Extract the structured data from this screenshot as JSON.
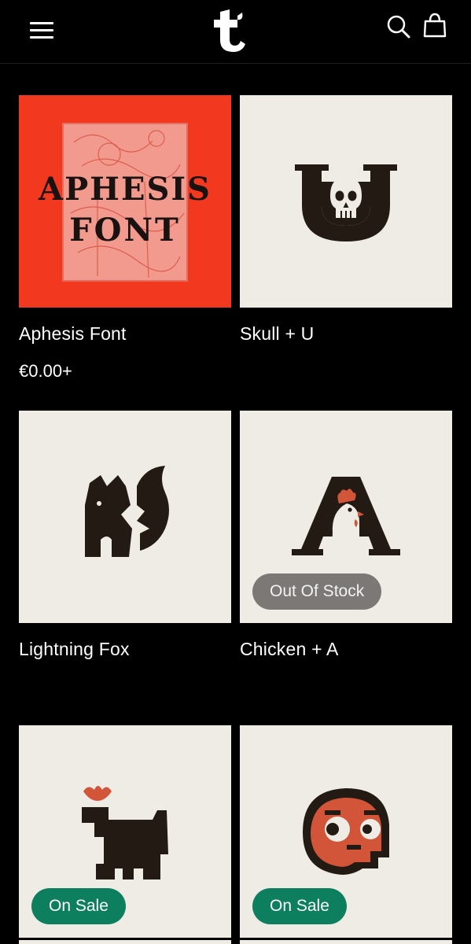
{
  "header": {
    "menu_icon": "hamburger-menu-icon",
    "logo_icon": "brand-t-logo",
    "search_icon": "search-icon",
    "cart_icon": "shopping-bag-icon"
  },
  "colors": {
    "background": "#000000",
    "card_background": "#efebe5",
    "aphesis_red": "#f2381e",
    "ink": "#231a14",
    "accent_orange": "#d2553a",
    "sale_badge": "#0d7f5f",
    "stock_badge": "#7b7876"
  },
  "products": [
    {
      "title": "Aphesis Font",
      "price": "€0.00+",
      "artwork_text_line1": "APHESIS",
      "artwork_text_line2": "FONT",
      "artwork": "aphesis-font-cover"
    },
    {
      "title": "Skull + U",
      "artwork": "skull-u-logo"
    },
    {
      "title": "Lightning Fox",
      "artwork": "lightning-fox-logo"
    },
    {
      "title": "Chicken + A",
      "badge": "Out Of Stock",
      "artwork": "chicken-a-logo"
    },
    {
      "badge": "On Sale",
      "artwork": "dog-flower-logo"
    },
    {
      "badge": "On Sale",
      "artwork": "skull-face-logo"
    }
  ]
}
